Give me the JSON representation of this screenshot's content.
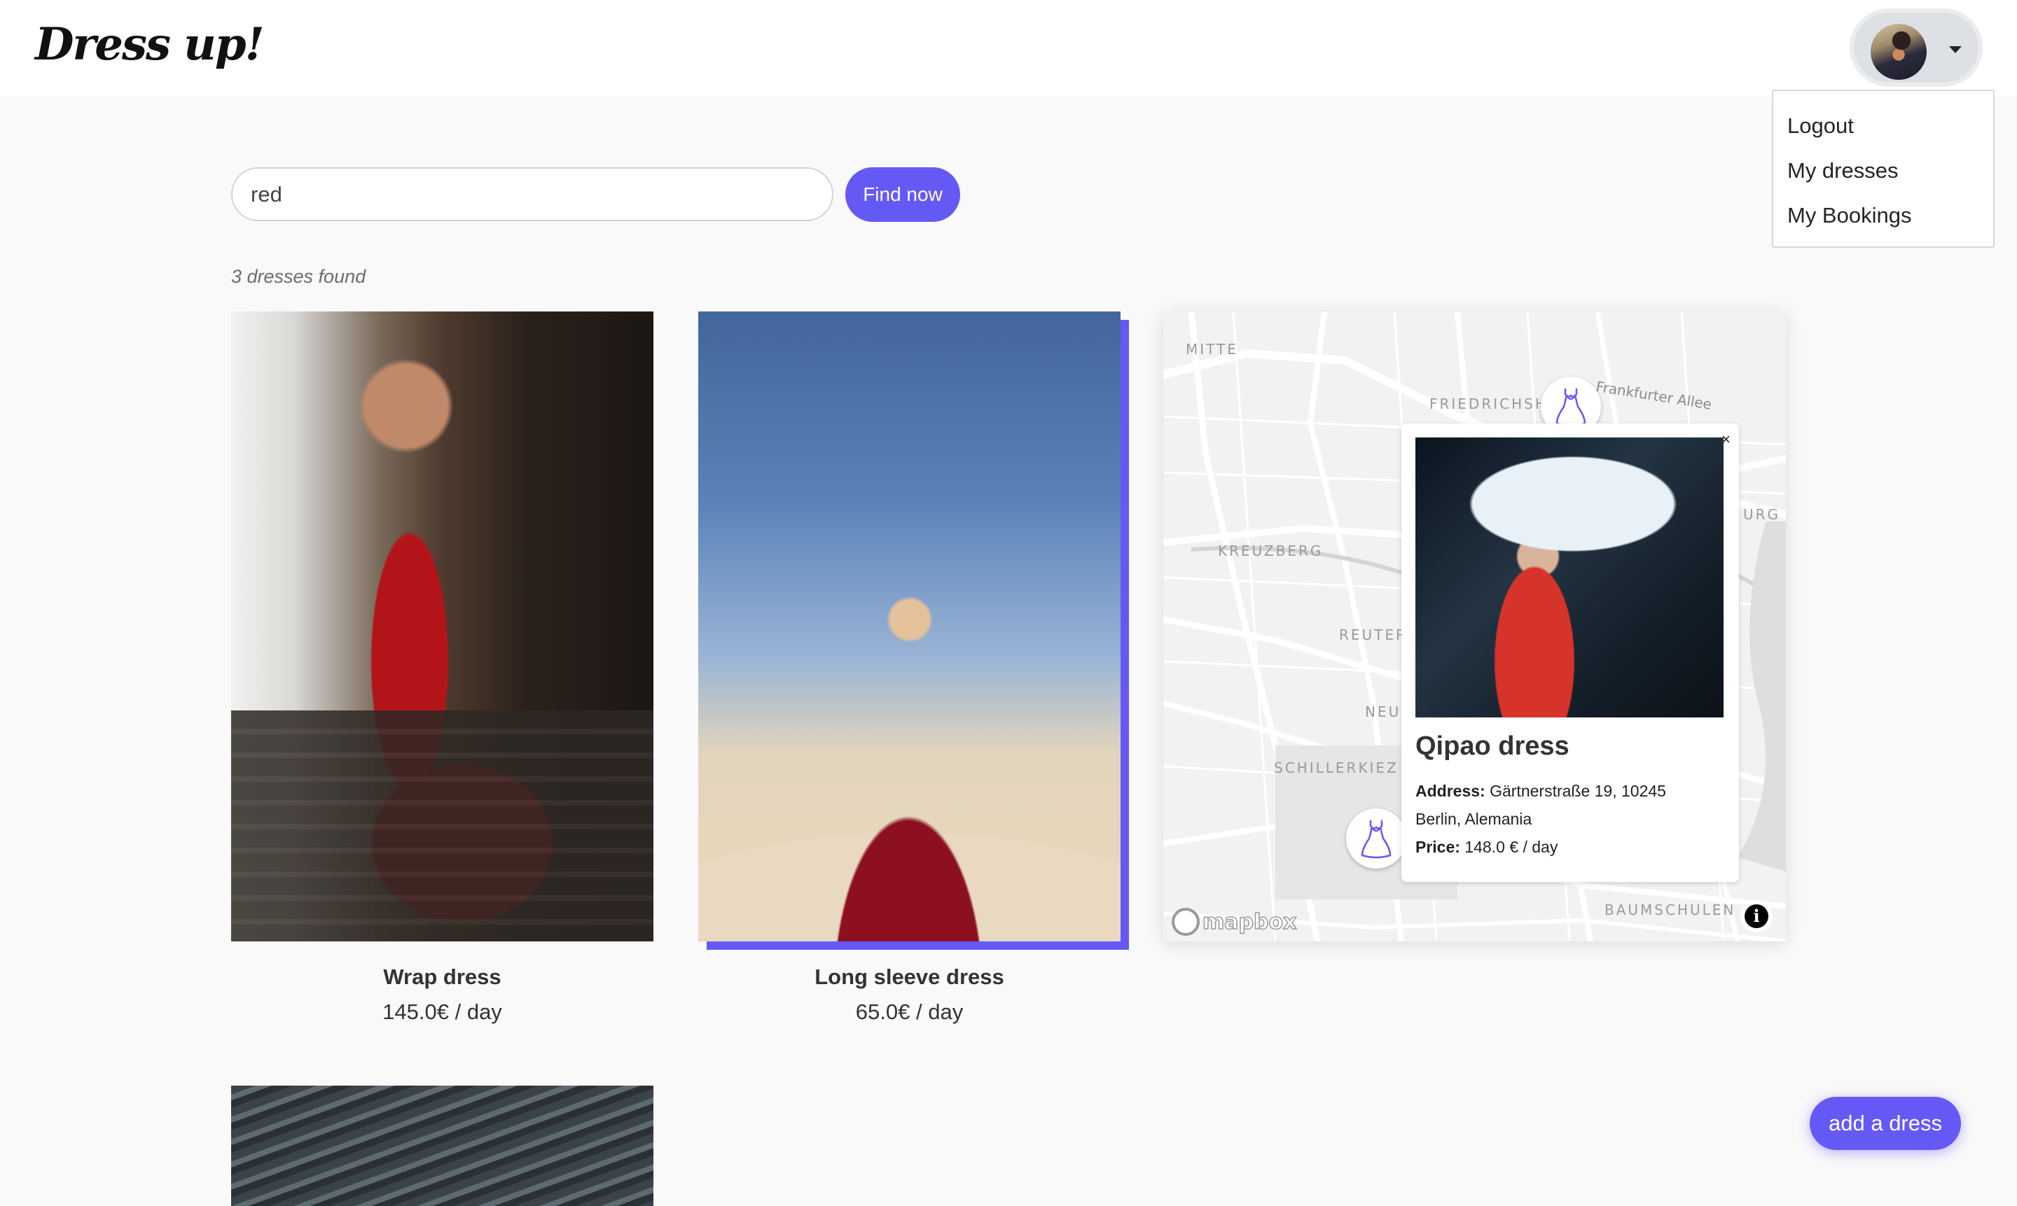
{
  "navbar": {
    "logo": "Dress up!",
    "user_menu": {
      "items": [
        {
          "label": "Logout"
        },
        {
          "label": "My dresses"
        },
        {
          "label": "My Bookings"
        }
      ]
    }
  },
  "search": {
    "value": "red",
    "button_label": "Find now"
  },
  "results": {
    "count_text": "3 dresses found",
    "dresses": [
      {
        "title": "Wrap dress",
        "price": "145.0€ / day"
      },
      {
        "title": "Long sleeve dress",
        "price": "65.0€ / day"
      },
      {
        "title": "Qipao dress",
        "price": "148.0 € / day"
      }
    ]
  },
  "map": {
    "labels": [
      "MITTE",
      "FRIEDRICHSH",
      "KREUZBERG",
      "REUTER",
      "NEU",
      "SCHILLERKIEZ",
      "BAUMSCHULEN",
      "URG"
    ],
    "street": "Frankfurter Allee",
    "attribution": "mapbox",
    "popup": {
      "close": "×",
      "title": "Qipao dress",
      "address_label": "Address:",
      "address_line1": "Gärtnerstraße 19, 10245",
      "address_line2": "Berlin, Alemania",
      "price_label": "Price:",
      "price": "148.0 € / day"
    }
  },
  "fab": {
    "label": "add a dress"
  },
  "colors": {
    "accent": "#6559f6",
    "background": "#f9f9f9"
  }
}
